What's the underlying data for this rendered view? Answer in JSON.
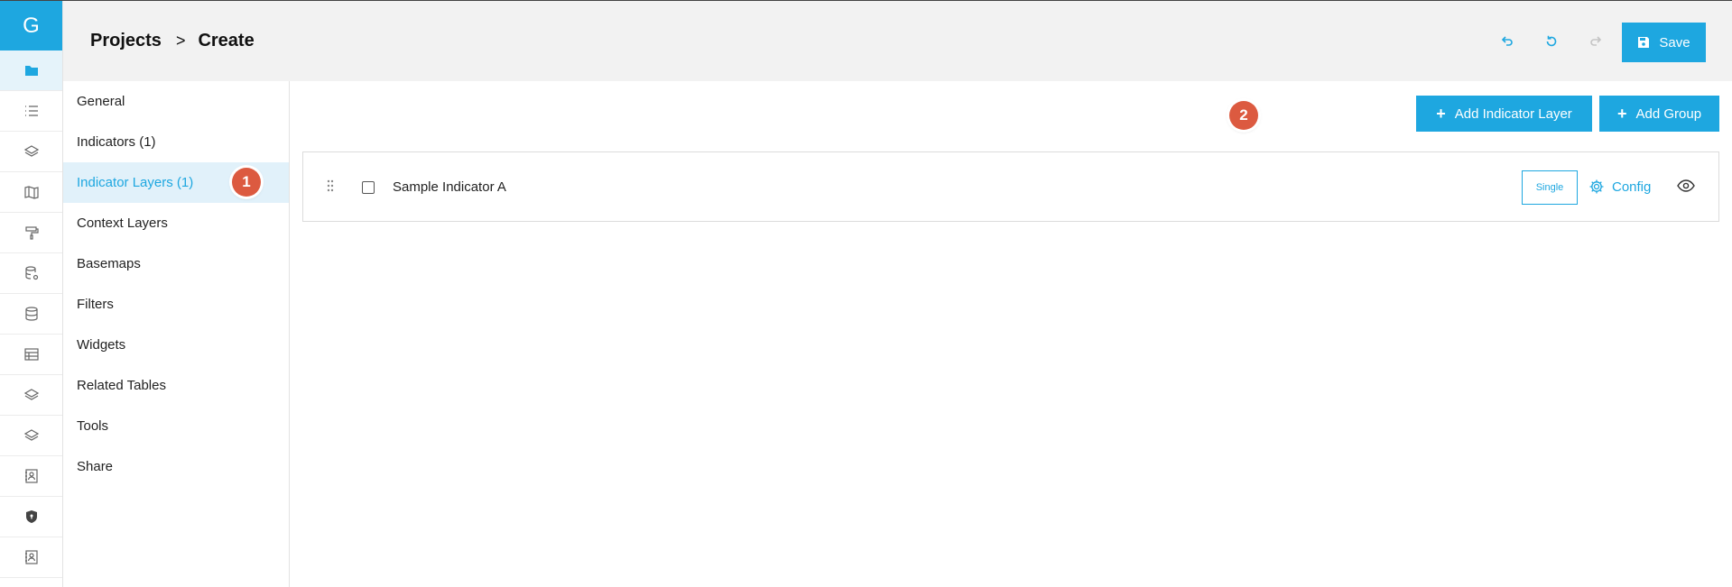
{
  "app": {
    "logo_letter": "G"
  },
  "rail": {
    "items": [
      {
        "icon": "folder-icon",
        "active": true
      },
      {
        "icon": "list-icon"
      },
      {
        "icon": "layers-icon"
      },
      {
        "icon": "map-icon"
      },
      {
        "icon": "paint-roller-icon"
      },
      {
        "icon": "database-settings-icon"
      },
      {
        "icon": "database-icon"
      },
      {
        "icon": "table-icon"
      },
      {
        "icon": "layers-icon"
      },
      {
        "icon": "layers-icon"
      },
      {
        "icon": "contact-book-icon"
      },
      {
        "icon": "shield-icon"
      },
      {
        "icon": "contact-book-icon"
      }
    ]
  },
  "header": {
    "breadcrumb": {
      "root": "Projects",
      "separator": ">",
      "current": "Create"
    },
    "undo_icon": "undo-icon",
    "reset_icon": "reset-icon",
    "redo_icon": "redo-icon",
    "save_label": "Save"
  },
  "nav": {
    "items": [
      {
        "label": "General"
      },
      {
        "label": "Indicators (1)"
      },
      {
        "label": "Indicator Layers (1)",
        "active": true
      },
      {
        "label": "Context Layers"
      },
      {
        "label": "Basemaps"
      },
      {
        "label": "Filters"
      },
      {
        "label": "Widgets"
      },
      {
        "label": "Related Tables"
      },
      {
        "label": "Tools"
      },
      {
        "label": "Share"
      }
    ]
  },
  "main": {
    "add_indicator_layer_label": "Add Indicator Layer",
    "add_group_label": "Add Group",
    "layers": [
      {
        "name": "Sample Indicator A",
        "tag": "Single",
        "config_label": "Config"
      }
    ]
  },
  "annotations": {
    "step1": "1",
    "step2": "2"
  },
  "colors": {
    "accent": "#1ea7e0",
    "badge": "#dc5a40",
    "active_bg": "#e1f1fa",
    "header_bg": "#f2f2f2"
  }
}
